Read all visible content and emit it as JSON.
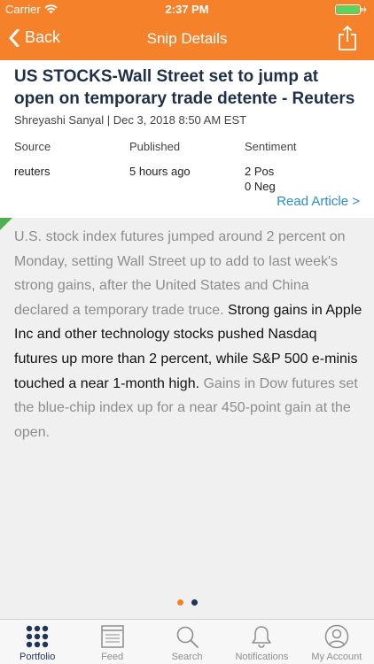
{
  "status": {
    "carrier": "Carrier",
    "time": "2:37 PM"
  },
  "nav": {
    "back_label": "Back",
    "title": "Snip Details"
  },
  "article": {
    "headline": "US STOCKS-Wall Street set to jump at open on temporary trade detente - Reuters",
    "byline": "Shreyashi   Sanyal | Dec 3, 2018 8:50 AM EST",
    "source_label": "Source",
    "source_value": "reuters",
    "published_label": "Published",
    "published_value": "5 hours ago",
    "sentiment_label": "Sentiment",
    "sentiment_pos": "2 Pos",
    "sentiment_neg": "0 Neg",
    "read_link": "Read Article >",
    "body_intro": "U.S. stock index futures jumped around 2 percent on Monday, setting Wall Street up to add to last week's strong gains, after the United States and China declared a temporary trade truce. ",
    "body_highlight": "Strong gains in Apple Inc and other technology stocks pushed Nasdaq futures up more than 2 percent, while S&P 500 e-minis touched a near 1-month high.",
    "body_outro": " Gains in Dow futures set the blue-chip index up for a near 450-point gain at the open."
  },
  "pager": {
    "count": 2,
    "active_index": 0
  },
  "tabs": [
    {
      "label": "Portfolio",
      "icon": "grid-icon"
    },
    {
      "label": "Feed",
      "icon": "newspaper-icon"
    },
    {
      "label": "Search",
      "icon": "search-icon"
    },
    {
      "label": "Notifications",
      "icon": "bell-icon"
    },
    {
      "label": "My Account",
      "icon": "user-icon"
    }
  ],
  "colors": {
    "brand_orange": "#f5822a",
    "link_blue": "#2a8ccf",
    "active_tab": "#1f3456",
    "battery_green": "#4cd964",
    "sentiment_corner": "#4caf50"
  }
}
